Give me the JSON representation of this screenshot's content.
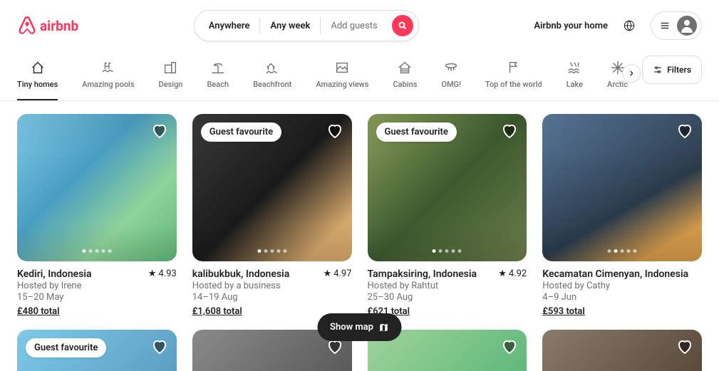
{
  "brand": {
    "name": "airbnb",
    "color": "#ff385c"
  },
  "search": {
    "where": "Anywhere",
    "when": "Any week",
    "who": "Add guests"
  },
  "header": {
    "host_cta": "Airbnb your home"
  },
  "filters_label": "Filters",
  "categories": [
    {
      "key": "tiny-homes",
      "label": "Tiny homes",
      "active": true
    },
    {
      "key": "amazing-pools",
      "label": "Amazing pools"
    },
    {
      "key": "design",
      "label": "Design"
    },
    {
      "key": "beach",
      "label": "Beach"
    },
    {
      "key": "beachfront",
      "label": "Beachfront"
    },
    {
      "key": "amazing-views",
      "label": "Amazing views"
    },
    {
      "key": "cabins",
      "label": "Cabins"
    },
    {
      "key": "omg",
      "label": "OMG!"
    },
    {
      "key": "top-of-world",
      "label": "Top of the world"
    },
    {
      "key": "lake",
      "label": "Lake"
    },
    {
      "key": "arctic",
      "label": "Arctic"
    }
  ],
  "guest_favourite_label": "Guest favourite",
  "listings": [
    {
      "location": "Kediri, Indonesia",
      "host": "Hosted by Irene",
      "dates": "15–20 May",
      "price": "£480 total",
      "rating": "4.93",
      "fav": false
    },
    {
      "location": "kalibukbuk, Indonesia",
      "host": "Hosted by a business",
      "dates": "14–19 Aug",
      "price": "£1,608 total",
      "rating": "4.97",
      "fav": true
    },
    {
      "location": "Tampaksiring, Indonesia",
      "host": "Hosted by Rahtut",
      "dates": "25–30 Aug",
      "price": "£621 total",
      "rating": "4.92",
      "fav": true
    },
    {
      "location": "Kecamatan Cimenyan, Indonesia",
      "host": "Hosted by Cathy",
      "dates": "4–9 Jun",
      "price": "£593 total",
      "rating": null,
      "fav": false
    }
  ],
  "row2": [
    {
      "fav": true
    },
    {
      "fav": false
    },
    {
      "fav": false
    },
    {
      "fav": false
    }
  ],
  "show_map_label": "Show map"
}
